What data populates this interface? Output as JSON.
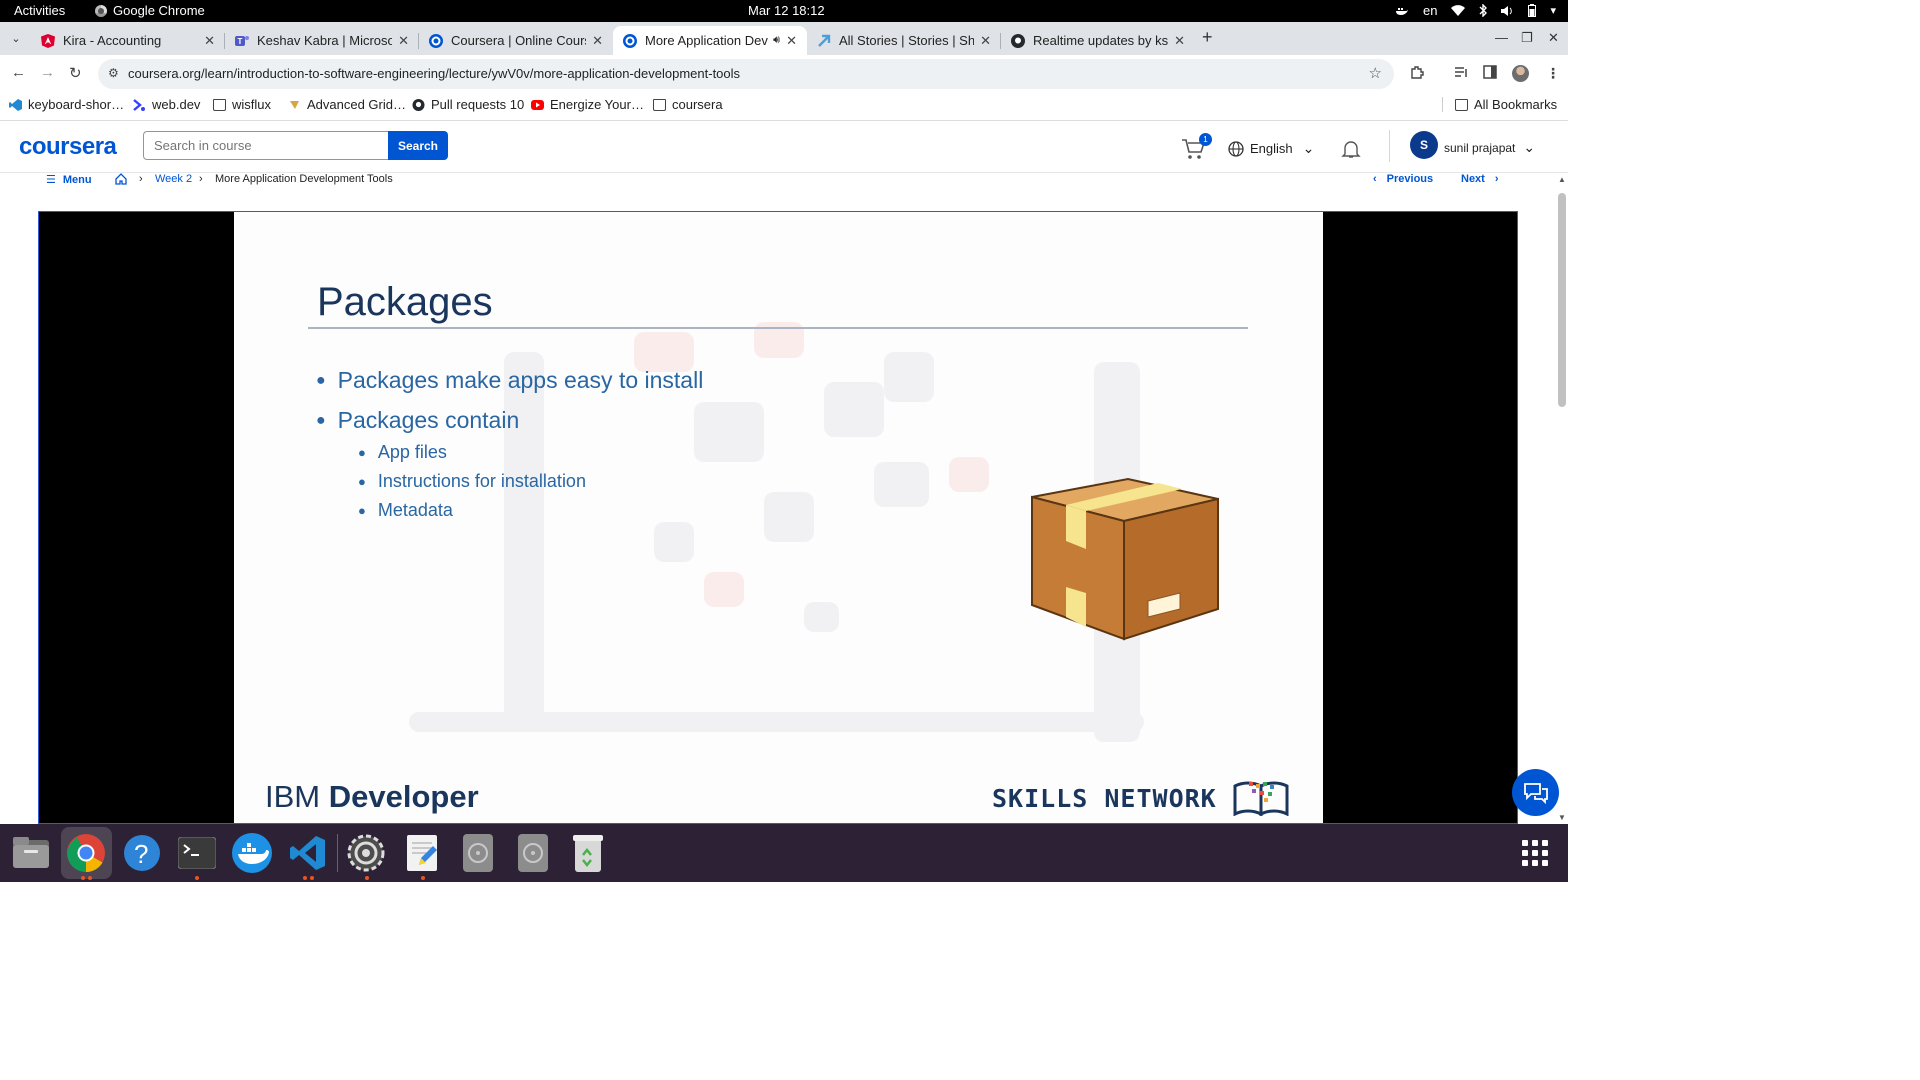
{
  "system_bar": {
    "activities": "Activities",
    "app_name": "Google Chrome",
    "clock": "Mar 12  18:12",
    "lang": "en"
  },
  "tabs": [
    {
      "title": "Kira - Accounting",
      "icon": "angular-icon",
      "color": "#dd0031"
    },
    {
      "title": "Keshav Kabra | Microsoft",
      "icon": "teams-icon",
      "color": "#5059c9"
    },
    {
      "title": "Coursera | Online Course",
      "icon": "coursera-icon",
      "color": "#0056d2"
    },
    {
      "title": "More Application Dev",
      "icon": "coursera-icon",
      "color": "#0056d2",
      "active": true
    },
    {
      "title": "All Stories | Stories | Sho",
      "icon": "shortcut-icon",
      "color": "#4d9fd6"
    },
    {
      "title": "Realtime updates by ksv",
      "icon": "github-icon",
      "color": "#24292f"
    }
  ],
  "omnibox": {
    "url": "coursera.org/learn/introduction-to-software-engineering/lecture/ywV0v/more-application-development-tools"
  },
  "bookmarks": [
    {
      "label": "keyboard-shor…",
      "icon": "vscode-icon"
    },
    {
      "label": "web.dev",
      "icon": "webdev-icon"
    },
    {
      "label": "wisflux",
      "icon": "folder-icon"
    },
    {
      "label": "Advanced Grid…",
      "icon": "grid-icon"
    },
    {
      "label": "Pull requests 10",
      "icon": "github-icon"
    },
    {
      "label": "Energize Your…",
      "icon": "youtube-icon"
    },
    {
      "label": "coursera",
      "icon": "folder-icon"
    }
  ],
  "all_bookmarks": "All Bookmarks",
  "coursera": {
    "logo": "coursera",
    "search_placeholder": "Search in course",
    "search_button": "Search",
    "cart_count": "1",
    "language": "English",
    "user_initial": "S",
    "user_name": "sunil prajapat"
  },
  "breadcrumb": {
    "menu": "Menu",
    "week": "Week 2",
    "current": "More Application Development Tools",
    "previous": "Previous",
    "next": "Next"
  },
  "slide": {
    "title": "Packages",
    "bullets": [
      {
        "text": "Packages make apps easy to install",
        "sub": []
      },
      {
        "text": "Packages contain",
        "sub": [
          "App files",
          "Instructions for installation",
          "Metadata"
        ]
      }
    ],
    "footer_left_a": "IBM",
    "footer_left_b": "Developer",
    "footer_right": "SKILLS NETWORK"
  },
  "dock": [
    {
      "name": "files-icon"
    },
    {
      "name": "chrome-icon"
    },
    {
      "name": "help-icon"
    },
    {
      "name": "terminal-icon"
    },
    {
      "name": "docker-icon"
    },
    {
      "name": "vscode-icon"
    },
    {
      "name": "settings-icon"
    },
    {
      "name": "text-editor-icon"
    },
    {
      "name": "disk-icon"
    },
    {
      "name": "disk-icon-2"
    },
    {
      "name": "trash-icon"
    }
  ]
}
